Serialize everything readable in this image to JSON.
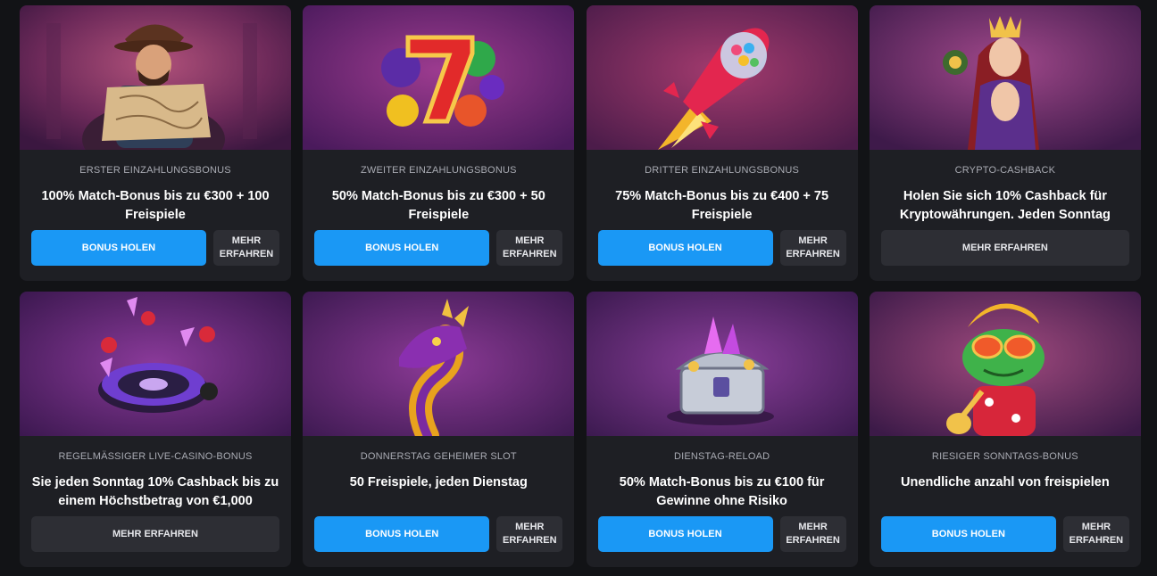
{
  "cards": [
    {
      "category": "ERSTER EINZAHLUNGSBONUS",
      "title": "100% Match-Bonus bis zu €300 + 100 Freispiele",
      "primary_label": "BONUS HOLEN",
      "secondary_label": "MEHR ERFAHREN",
      "image_icon": "adventurer-with-map-icon"
    },
    {
      "category": "ZWEITER EINZAHLUNGSBONUS",
      "title": "50% Match-Bonus bis zu €300 + 50 Freispiele",
      "primary_label": "BONUS HOLEN",
      "secondary_label": "MEHR ERFAHREN",
      "image_icon": "lucky-seven-fruits-icon"
    },
    {
      "category": "DRITTER EINZAHLUNGSBONUS",
      "title": "75% Match-Bonus bis zu €400 + 75 Freispiele",
      "primary_label": "BONUS HOLEN",
      "secondary_label": "MEHR ERFAHREN",
      "image_icon": "gumball-rocket-icon"
    },
    {
      "category": "CRYPTO-CASHBACK",
      "title": "Holen Sie sich 10% Cashback für Kryptowährungen. Jeden Sonntag",
      "secondary_label": "MEHR ERFAHREN",
      "image_icon": "crowned-queen-icon"
    },
    {
      "category": "REGELMÄßIGER LIVE-CASINO-BONUS",
      "title": "Sie jeden Sonntag 10% Cashback bis zu einem Höchstbetrag von €1,000",
      "secondary_label": "MEHR ERFAHREN",
      "image_icon": "roulette-wheel-icon"
    },
    {
      "category": "DONNERSTAG GEHEIMER SLOT",
      "title": "50 Freispiele, jeden Dienstag",
      "primary_label": "BONUS HOLEN",
      "secondary_label": "MEHR ERFAHREN",
      "image_icon": "golden-dragon-icon"
    },
    {
      "category": "DIENSTAG-RELOAD",
      "title": "50% Match-Bonus bis zu €100 für Gewinne ohne Risiko",
      "primary_label": "BONUS HOLEN",
      "secondary_label": "MEHR ERFAHREN",
      "image_icon": "treasure-chest-crystals-icon"
    },
    {
      "category": "RIESIGER SONNTAGS-BONUS",
      "title": "Unendliche anzahl von freispielen",
      "primary_label": "BONUS HOLEN",
      "secondary_label": "MEHR ERFAHREN",
      "image_icon": "rockstar-frog-guitar-icon"
    }
  ],
  "colors": {
    "page_bg": "#121316",
    "card_bg": "#1e1f24",
    "primary": "#1a98f5",
    "secondary": "#2d2e34",
    "muted_text": "#a9abb3"
  }
}
